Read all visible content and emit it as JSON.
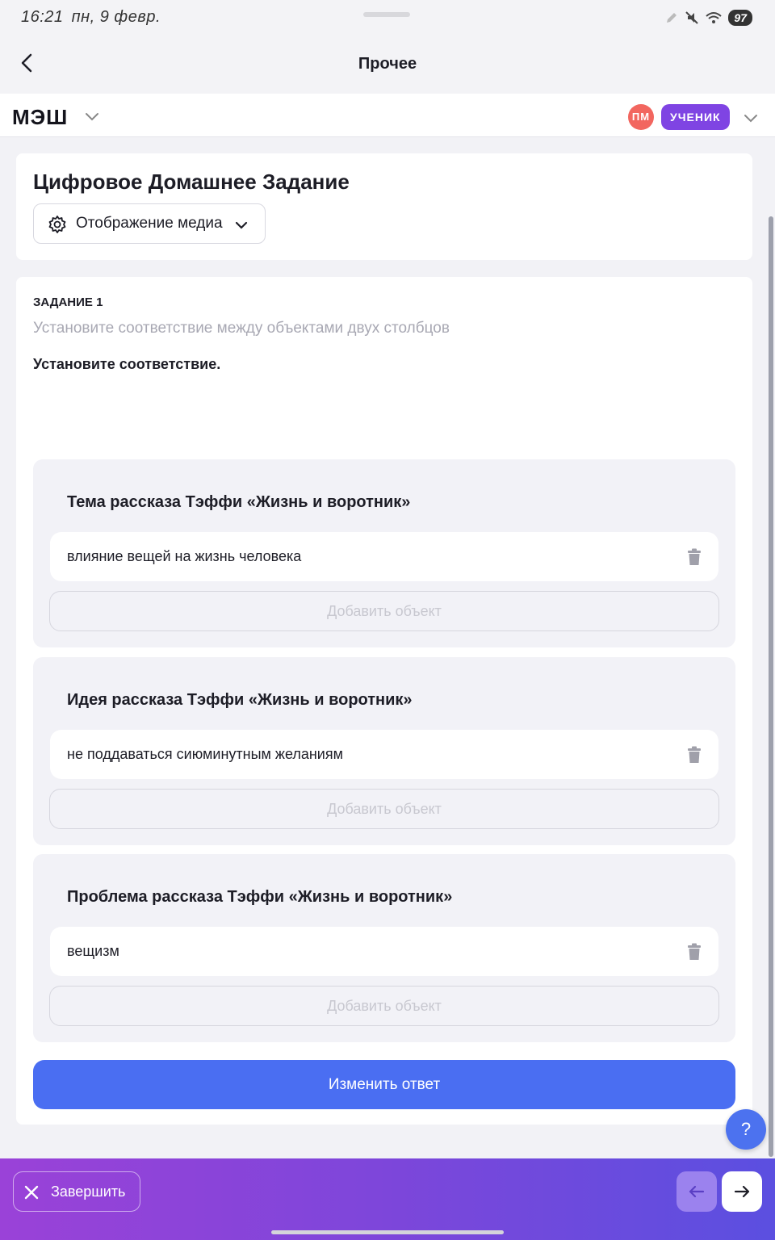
{
  "status_bar": {
    "time": "16:21",
    "date": "пн, 9 февр.",
    "battery": "97"
  },
  "header": {
    "title": "Прочее"
  },
  "app_bar": {
    "logo": "МЭШ",
    "avatar_initials": "ПМ",
    "role": "УЧЕНИК"
  },
  "page": {
    "title": "Цифровое Домашнее Задание",
    "media_button": "Отображение медиа"
  },
  "task": {
    "label": "ЗАДАНИЕ 1",
    "hint": "Установите соответствие между объектами двух столбцов",
    "instruction": "Установите соответствие.",
    "groups": [
      {
        "title": "Тема  рассказа Тэффи «Жизнь и воротник»",
        "answer": "влияние вещей на жизнь человека",
        "add_label": "Добавить объект"
      },
      {
        "title": "Идея рассказа Тэффи «Жизнь и воротник»",
        "answer": "не поддаваться сиюминутным желаниям",
        "add_label": "Добавить объект"
      },
      {
        "title": "Проблема  рассказа Тэффи «Жизнь и воротник»",
        "answer": "вещизм",
        "add_label": "Добавить объект"
      }
    ],
    "submit_label": "Изменить ответ"
  },
  "help_label": "?",
  "bottom_bar": {
    "finish_label": "Завершить"
  },
  "colors": {
    "accent_blue": "#4a6ef2",
    "role_purple": "#7f44e3",
    "avatar_red": "#f2665f"
  }
}
